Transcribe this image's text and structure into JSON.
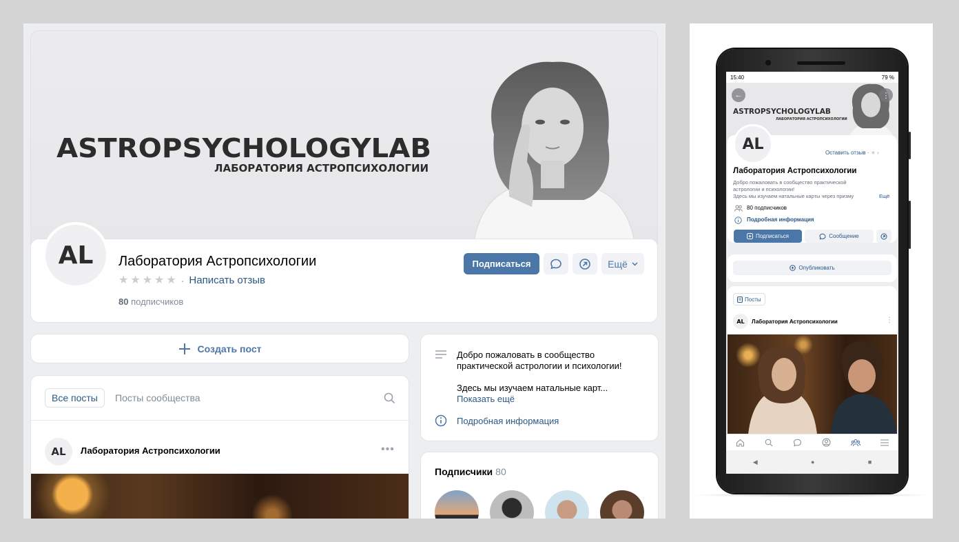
{
  "desktop": {
    "cover": {
      "brand": "ASTROPSYCHOLOGYLAB",
      "brand_sub": "ЛАБОРАТОРИЯ АСТРОПСИХОЛОГИИ"
    },
    "header": {
      "avatar_text": "AL",
      "title": "Лаборатория Астропсихологии",
      "rating_stars": 5,
      "review_link": "Написать отзыв",
      "subs_number": "80",
      "subs_label": "подписчиков",
      "subscribe_button": "Подписаться",
      "more_button": "Ещё"
    },
    "create_post": "Создать пост",
    "posts": {
      "tab_all": "Все посты",
      "tab_community": "Посты сообщества",
      "post_author_avatar": "AL",
      "post_author": "Лаборатория Астропсихологии",
      "post_menu": "•••"
    },
    "about": {
      "line1": "Добро пожаловать в сообщество практической астрологии и психологии!",
      "line2": "Здесь мы изучаем натальные карт...",
      "show_more": "Показать ещё",
      "detailed_info": "Подробная информация"
    },
    "subscribers": {
      "title": "Подписчики",
      "count": "80"
    }
  },
  "mobile": {
    "status_time": "15:40",
    "status_battery": "79 %",
    "cover": {
      "brand": "ASTROPSYCHOLOGYLAB",
      "brand_sub": "ЛАБОРАТОРИЯ АСТРОПСИХОЛОГИИ"
    },
    "avatar_text": "AL",
    "review_link": "Оставить отзыв ·",
    "title": "Лаборатория Астропсихологии",
    "desc_line1": "Добро пожаловать в сообщество практической",
    "desc_line2": "астрологии и психологии!",
    "desc_line3": "Здесь мы изучаем натальные карты через призму",
    "desc_more": "Ещё",
    "subscribers": "80 подписчиков",
    "detailed_info": "Подробная информация",
    "subscribe_button": "Подписаться",
    "message_button": "Сообщение",
    "publish_button": "Опубликовать",
    "posts_tab": "Посты",
    "post_author_avatar": "AL",
    "post_author": "Лаборатория Астропсихологии",
    "post_menu": "⋮"
  },
  "colors": {
    "accent": "#4a76a8",
    "link": "#2a5885",
    "muted": "#818c99",
    "page_bg": "#edeef0"
  }
}
